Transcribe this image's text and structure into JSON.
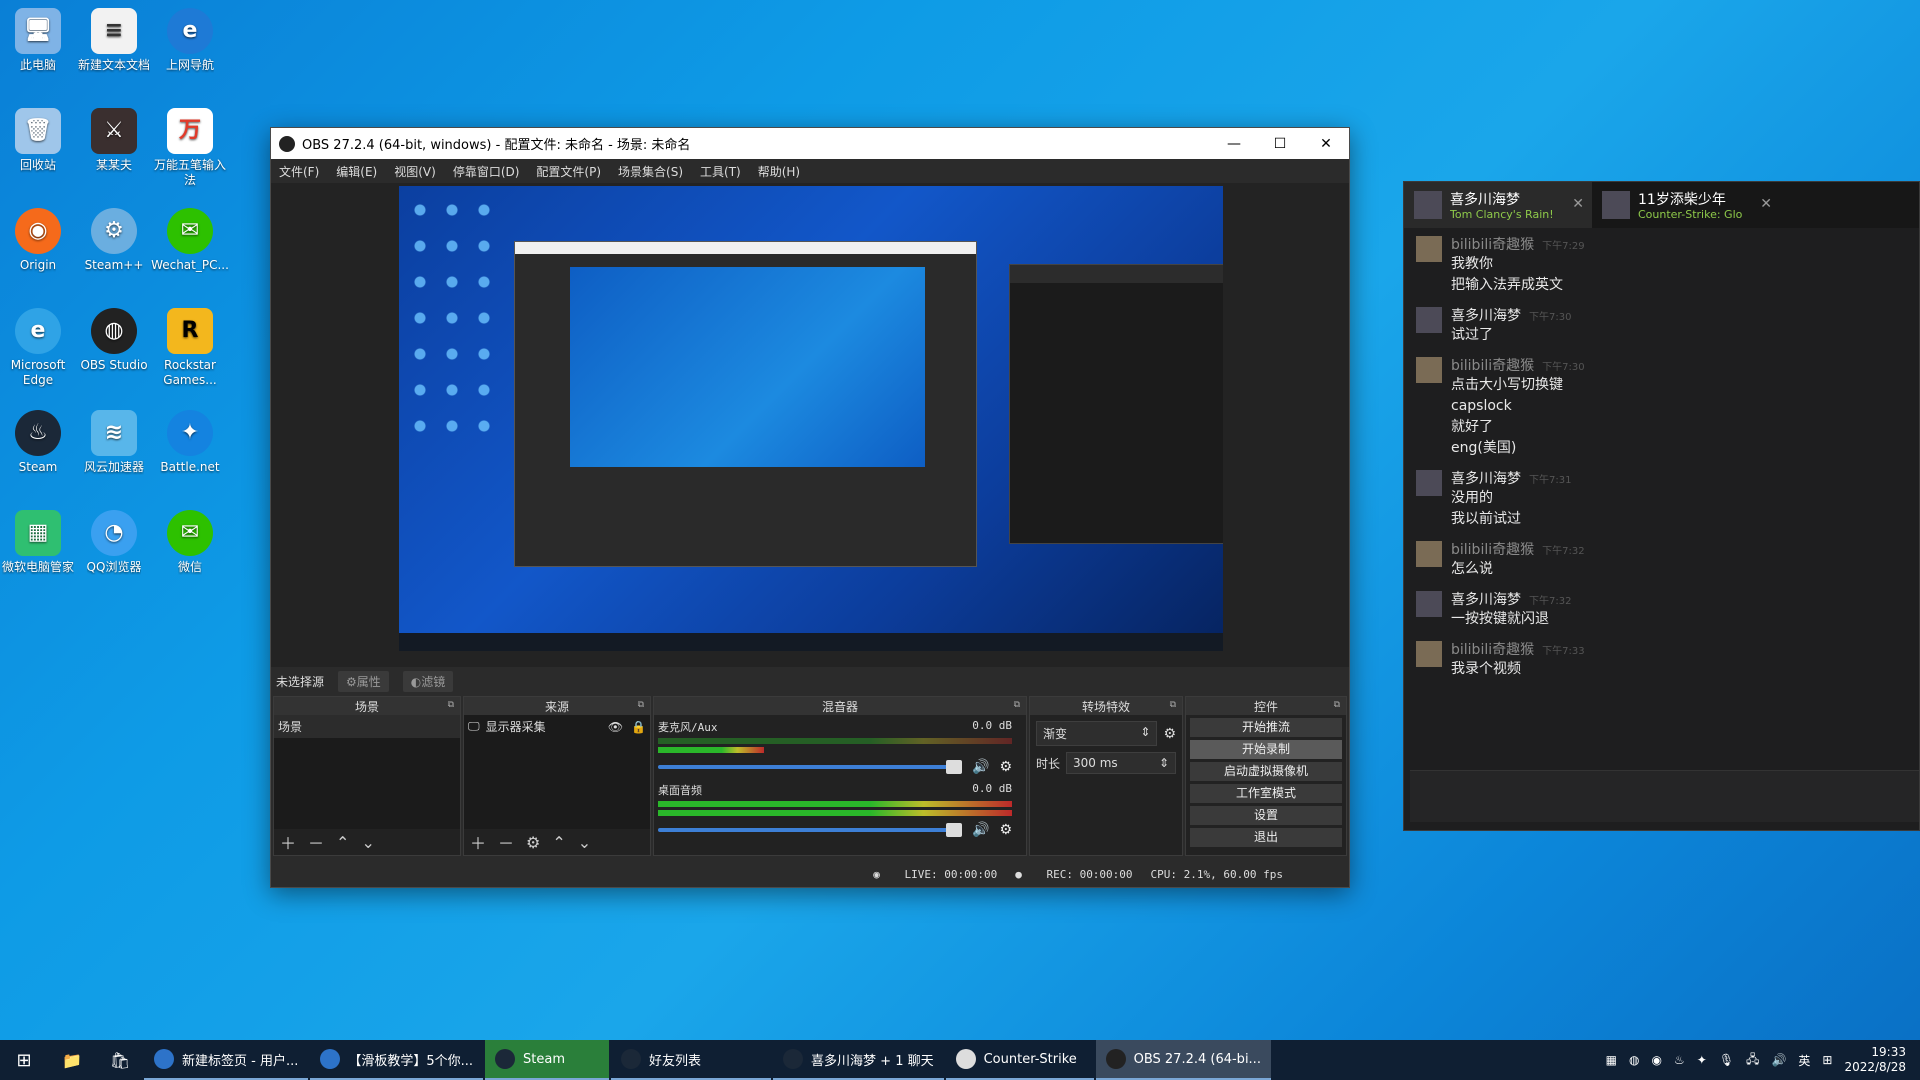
{
  "desktop": {
    "icons": [
      {
        "label": "此电脑"
      },
      {
        "label": "新建文本文档"
      },
      {
        "label": "上网导航"
      },
      {
        "label": "回收站"
      },
      {
        "label": "某某夫"
      },
      {
        "label": "万能五笔输入法"
      },
      {
        "label": "Origin"
      },
      {
        "label": "Steam++"
      },
      {
        "label": "Wechat_PC..."
      },
      {
        "label": "Microsoft Edge"
      },
      {
        "label": "OBS Studio"
      },
      {
        "label": "Rockstar Games..."
      },
      {
        "label": "Steam"
      },
      {
        "label": "风云加速器"
      },
      {
        "label": "Battle.net"
      },
      {
        "label": "微软电脑管家"
      },
      {
        "label": "QQ浏览器"
      },
      {
        "label": "微信"
      }
    ]
  },
  "obs": {
    "title": "OBS 27.2.4 (64-bit, windows) - 配置文件: 未命名 - 场景: 未命名",
    "window_controls": {
      "minimize": "—",
      "maximize": "☐",
      "close": "✕"
    },
    "menu": [
      "文件(F)",
      "编辑(E)",
      "视图(V)",
      "停靠窗口(D)",
      "配置文件(P)",
      "场景集合(S)",
      "工具(T)",
      "帮助(H)"
    ],
    "source_bar": {
      "no_source": "未选择源",
      "properties": "⚙属性",
      "filters": "◐滤镜"
    },
    "docks": {
      "scenes": {
        "title": "场景",
        "items": [
          "场景"
        ]
      },
      "sources": {
        "title": "来源",
        "items": [
          "显示器采集"
        ]
      },
      "mixer": {
        "title": "混音器",
        "channels": [
          {
            "name": "麦克风/Aux",
            "db": "0.0 dB"
          },
          {
            "name": "桌面音频",
            "db": "0.0 dB"
          }
        ]
      },
      "transitions": {
        "title": "转场特效",
        "type": "渐变",
        "duration_label": "时长",
        "duration": "300 ms"
      },
      "controls": {
        "title": "控件",
        "buttons": [
          "开始推流",
          "开始录制",
          "启动虚拟摄像机",
          "工作室模式",
          "设置",
          "退出"
        ]
      }
    },
    "status": {
      "live": "LIVE: 00:00:00",
      "rec": "REC: 00:00:00",
      "cpu": "CPU: 2.1%, 60.00 fps"
    }
  },
  "steam_chat": {
    "tabs": [
      {
        "name": "喜多川海梦",
        "game": "Tom Clancy's Rain!"
      },
      {
        "name": "11岁添柴少年",
        "game": "Counter-Strike: Glo"
      }
    ],
    "messages": [
      {
        "sender": "bilibili奇趣猴",
        "time": "下午7:29",
        "me": false,
        "lines": [
          "我教你",
          "把输入法弄成英文"
        ]
      },
      {
        "sender": "喜多川海梦",
        "time": "下午7:30",
        "me": true,
        "lines": [
          "试过了"
        ]
      },
      {
        "sender": "bilibili奇趣猴",
        "time": "下午7:30",
        "me": false,
        "lines": [
          "点击大小写切换键",
          "capslock",
          "就好了",
          "eng(美国)"
        ]
      },
      {
        "sender": "喜多川海梦",
        "time": "下午7:31",
        "me": true,
        "lines": [
          "没用的",
          "我以前试过"
        ]
      },
      {
        "sender": "bilibili奇趣猴",
        "time": "下午7:32",
        "me": false,
        "lines": [
          "怎么说"
        ]
      },
      {
        "sender": "喜多川海梦",
        "time": "下午7:32",
        "me": true,
        "lines": [
          "一按按键就闪退"
        ]
      },
      {
        "sender": "bilibili奇趣猴",
        "time": "下午7:33",
        "me": false,
        "lines": [
          "我录个视频"
        ]
      }
    ]
  },
  "taskbar": {
    "apps": [
      {
        "label": "新建标签页 - 用户..."
      },
      {
        "label": "【滑板教学】5个你..."
      },
      {
        "label": "Steam"
      },
      {
        "label": "好友列表"
      },
      {
        "label": "喜多川海梦 + 1 聊天"
      },
      {
        "label": "Counter-Strike"
      },
      {
        "label": "OBS 27.2.4 (64-bi..."
      }
    ],
    "tray_lang": "英",
    "time": "19:33",
    "date": "2022/8/28"
  }
}
